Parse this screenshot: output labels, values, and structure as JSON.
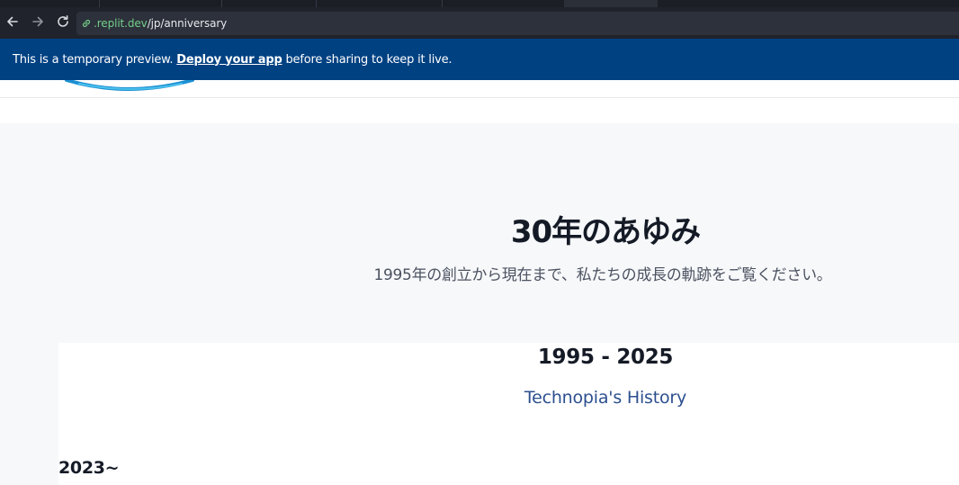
{
  "browser": {
    "url_domain": ".replit.dev",
    "url_path": "/jp/anniversary",
    "icons": [
      "back-arrow-icon",
      "forward-arrow-icon",
      "reload-icon",
      "link-icon"
    ]
  },
  "banner": {
    "text_before": "This is a temporary preview. ",
    "link_text": "Deploy your app",
    "text_after": " before sharing to keep it live.",
    "background_color": "#004182"
  },
  "hero": {
    "title": "30年のあゆみ",
    "subtitle": "1995年の創立から現在まで、私たちの成長の軌跡をご覧ください。"
  },
  "history": {
    "range": "1995 - 2025",
    "subtitle": "Technopia's History",
    "era": "2023~",
    "accent_color": "#2c4f8f"
  }
}
